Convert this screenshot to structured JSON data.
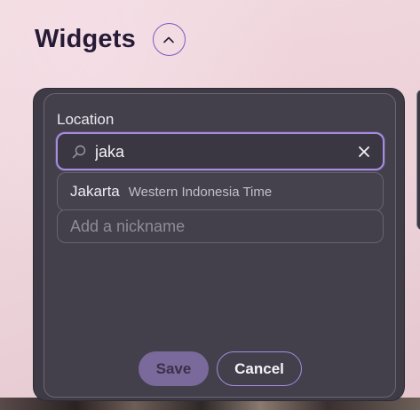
{
  "header": {
    "title": "Widgets",
    "collapse_icon": "chevron-up-icon"
  },
  "location_form": {
    "label": "Location",
    "search": {
      "value": "jaka",
      "icon": "search-icon",
      "clear_icon": "close-icon"
    },
    "suggestions": [
      {
        "city": "Jakarta",
        "timezone": "Western Indonesia Time"
      }
    ],
    "nickname": {
      "placeholder": "Add a nickname",
      "value": ""
    },
    "actions": {
      "save_label": "Save",
      "cancel_label": "Cancel"
    }
  },
  "colors": {
    "accent": "#a68de0",
    "panel": "#3e3b47",
    "title": "#261b36",
    "save_button_disabled": "#7a6a9c"
  }
}
